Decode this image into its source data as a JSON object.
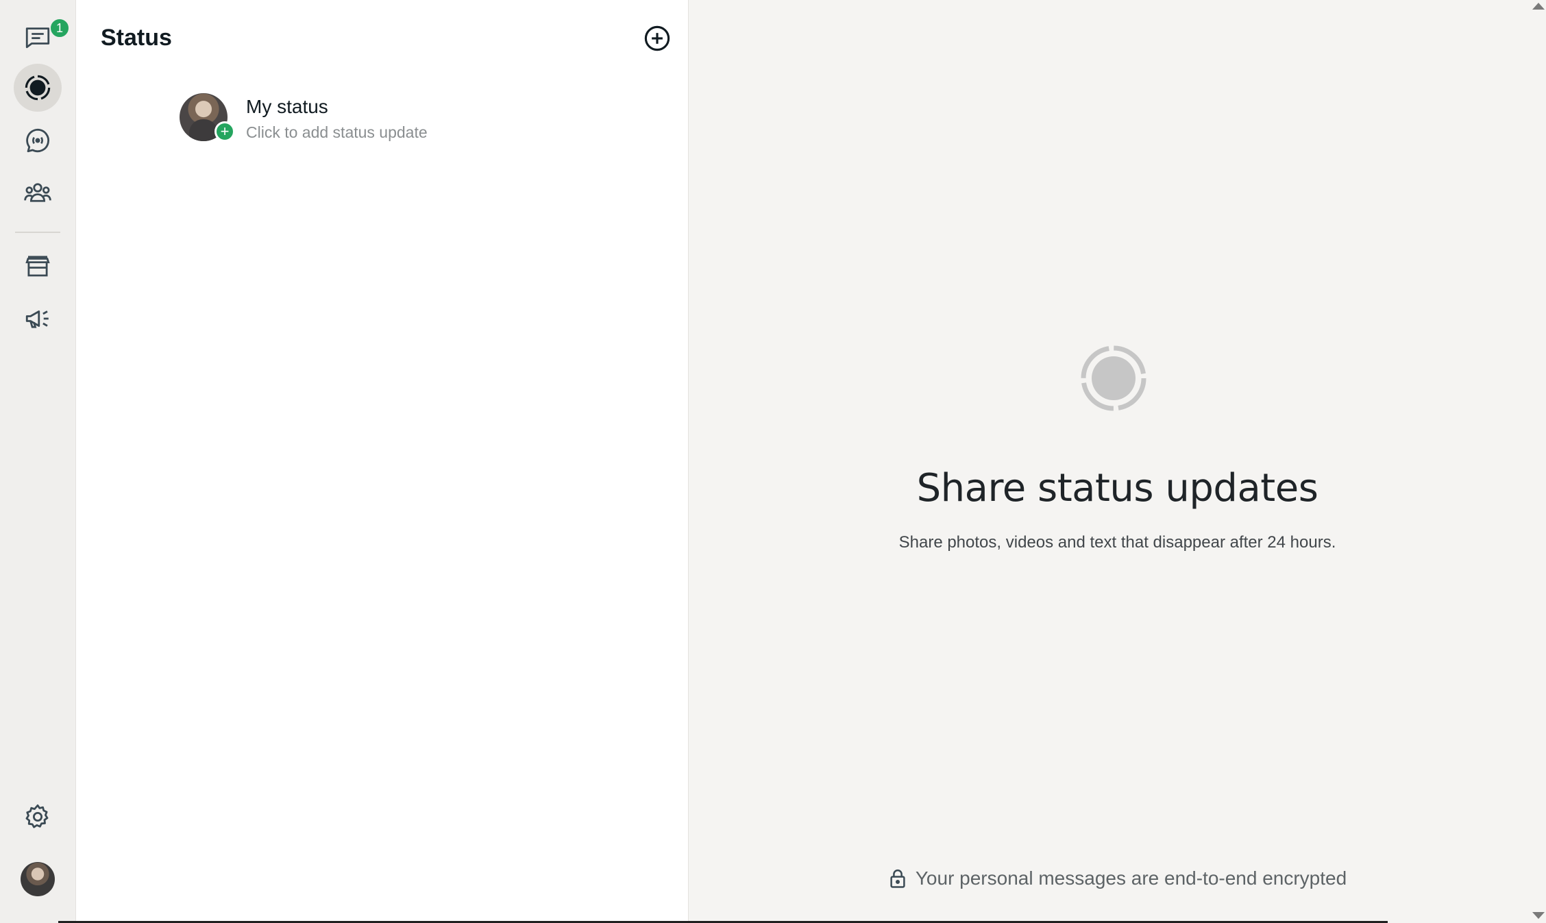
{
  "rail": {
    "chats": {
      "icon": "chats-icon",
      "badge": "1"
    },
    "status": {
      "icon": "status-icon",
      "active": true
    },
    "channels": {
      "icon": "channels-icon"
    },
    "communities": {
      "icon": "communities-icon"
    },
    "store": {
      "icon": "store-icon"
    },
    "broadcast": {
      "icon": "megaphone-icon"
    },
    "settings": {
      "icon": "gear-icon"
    },
    "profile": {
      "icon": "avatar"
    }
  },
  "panel": {
    "title": "Status",
    "add_icon": "add-circle-icon",
    "menu_icon": "more-vertical-icon",
    "my_status": {
      "name": "My status",
      "subtitle": "Click to add status update",
      "add_badge": "+"
    }
  },
  "detail": {
    "icon": "status-ring-icon",
    "title": "Share status updates",
    "subtitle": "Share photos, videos and text that disappear after 24 hours.",
    "footer": "Your personal messages are end-to-end encrypted",
    "footer_icon": "lock-icon"
  },
  "colors": {
    "accent_green": "#25a55f",
    "rail_bg": "#f0efed",
    "detail_bg": "#f5f4f2"
  }
}
